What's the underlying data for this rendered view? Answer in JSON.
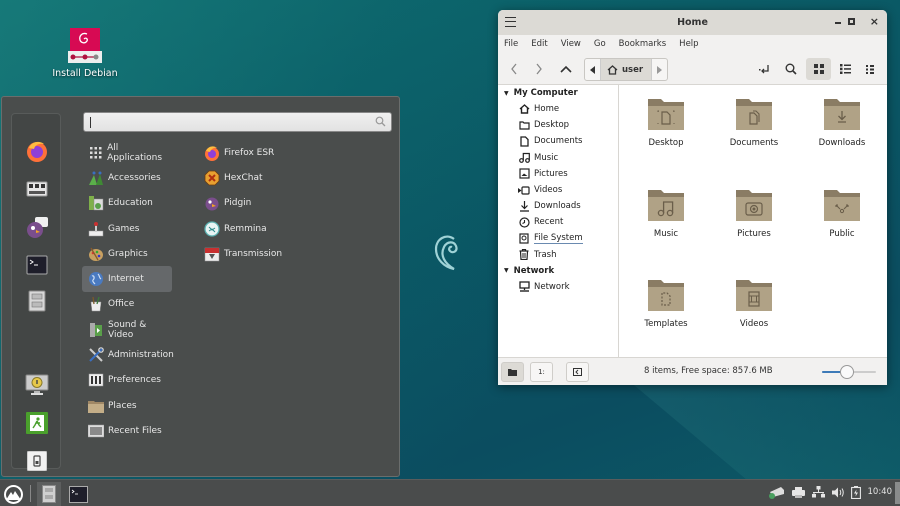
{
  "desktop": {
    "icons": [
      {
        "label": "Install Debian",
        "icon": "debian-installer-icon"
      }
    ]
  },
  "menu": {
    "search": {
      "value": "",
      "placeholder": ""
    },
    "favorites": [
      {
        "name": "firefox",
        "icon": "firefox-icon"
      },
      {
        "name": "keyboard-settings",
        "icon": "keyboard-icon"
      },
      {
        "name": "pidgin",
        "icon": "pidgin-icon"
      },
      {
        "name": "terminal",
        "icon": "terminal-icon"
      },
      {
        "name": "files",
        "icon": "file-cabinet-icon"
      },
      {
        "name": "lock-screen",
        "icon": "lock-screen-icon"
      },
      {
        "name": "logout",
        "icon": "exit-icon"
      },
      {
        "name": "shutdown",
        "icon": "power-icon"
      }
    ],
    "categories": [
      {
        "label": "All Applications",
        "icon": "grid-icon"
      },
      {
        "label": "Accessories",
        "icon": "accessories-icon"
      },
      {
        "label": "Education",
        "icon": "education-icon"
      },
      {
        "label": "Games",
        "icon": "joystick-icon"
      },
      {
        "label": "Graphics",
        "icon": "palette-icon"
      },
      {
        "label": "Internet",
        "icon": "globe-icon",
        "selected": true
      },
      {
        "label": "Office",
        "icon": "office-icon"
      },
      {
        "label": "Sound & Video",
        "icon": "multimedia-icon"
      },
      {
        "label": "Administration",
        "icon": "tools-icon"
      },
      {
        "label": "Preferences",
        "icon": "preferences-icon"
      },
      {
        "label": "Places",
        "icon": "folder-icon"
      },
      {
        "label": "Recent Files",
        "icon": "recent-files-icon"
      }
    ],
    "apps": [
      {
        "label": "Firefox ESR",
        "icon": "firefox-icon"
      },
      {
        "label": "HexChat",
        "icon": "hexchat-icon"
      },
      {
        "label": "Pidgin",
        "icon": "pidgin-icon"
      },
      {
        "label": "Remmina",
        "icon": "remmina-icon"
      },
      {
        "label": "Transmission",
        "icon": "transmission-icon"
      }
    ]
  },
  "file_manager": {
    "title": "Home",
    "menubar": [
      "File",
      "Edit",
      "View",
      "Go",
      "Bookmarks",
      "Help"
    ],
    "breadcrumb": {
      "current": "user"
    },
    "sidebar": {
      "sections": [
        {
          "label": "My Computer",
          "items": [
            {
              "label": "Home",
              "icon": "home-icon"
            },
            {
              "label": "Desktop",
              "icon": "folder-icon"
            },
            {
              "label": "Documents",
              "icon": "document-icon"
            },
            {
              "label": "Music",
              "icon": "music-icon"
            },
            {
              "label": "Pictures",
              "icon": "picture-icon"
            },
            {
              "label": "Videos",
              "icon": "video-icon"
            },
            {
              "label": "Downloads",
              "icon": "download-icon"
            },
            {
              "label": "Recent",
              "icon": "clock-icon"
            },
            {
              "label": "File System",
              "icon": "drive-icon"
            },
            {
              "label": "Trash",
              "icon": "trash-icon"
            }
          ]
        },
        {
          "label": "Network",
          "items": [
            {
              "label": "Network",
              "icon": "network-icon"
            }
          ]
        }
      ]
    },
    "files": [
      {
        "label": "Desktop",
        "emblem": "desktop"
      },
      {
        "label": "Documents",
        "emblem": "documents"
      },
      {
        "label": "Downloads",
        "emblem": "downloads"
      },
      {
        "label": "Music",
        "emblem": "music"
      },
      {
        "label": "Pictures",
        "emblem": "pictures"
      },
      {
        "label": "Public",
        "emblem": "public"
      },
      {
        "label": "Templates",
        "emblem": "templates"
      },
      {
        "label": "Videos",
        "emblem": "videos"
      }
    ],
    "status": "8 items, Free space: 857.6 MB",
    "zoom_level_percent": 45
  },
  "taskbar": {
    "clock": "10:40"
  },
  "colors": {
    "folder": "#b0a286",
    "folder_dark": "#8a7c64",
    "debian_red": "#d70a53",
    "menu_bg": "#4a4d4c",
    "slider_accent": "#3d7ab8"
  }
}
